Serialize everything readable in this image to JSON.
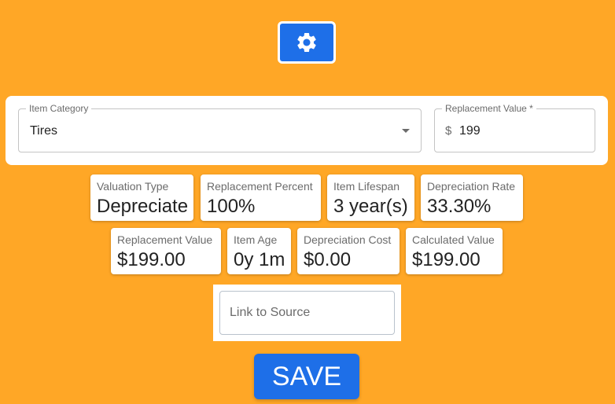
{
  "toolbar": {
    "settings_icon": "gear-icon"
  },
  "form": {
    "category": {
      "label": "Item Category",
      "value": "Tires"
    },
    "replacement": {
      "label": "Replacement Value *",
      "currency": "$",
      "value": "199"
    }
  },
  "stats": [
    {
      "label": "Valuation Type",
      "value": "Depreciate"
    },
    {
      "label": "Replacement Percent",
      "value": "100%"
    },
    {
      "label": "Item Lifespan",
      "value": "3 year(s)"
    },
    {
      "label": "Depreciation Rate",
      "value": "33.30%"
    },
    {
      "label": "Replacement Value",
      "value": "$199.00"
    },
    {
      "label": "Item Age",
      "value": "0y 1m"
    },
    {
      "label": "Depreciation Cost",
      "value": "$0.00"
    },
    {
      "label": "Calculated Value",
      "value": "$199.00"
    }
  ],
  "link": {
    "placeholder": "Link to Source",
    "value": ""
  },
  "save": {
    "label": "SAVE"
  },
  "colors": {
    "background": "#ffa726",
    "accent": "#1e6fe8"
  }
}
